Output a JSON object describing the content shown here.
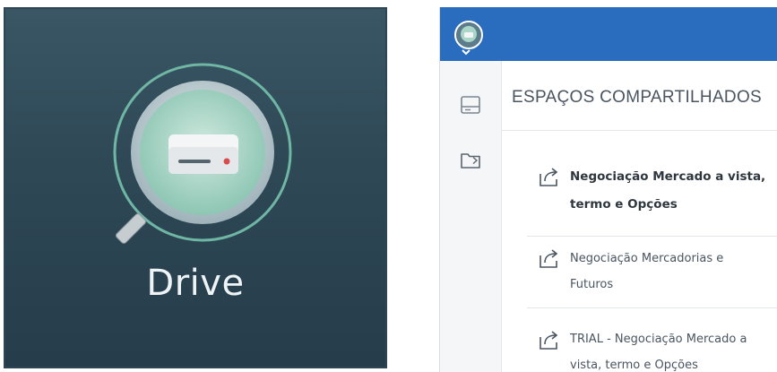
{
  "drive_tile": {
    "label": "Drive",
    "icon": "hard-drive-icon",
    "colors": {
      "background": "#2f4957",
      "ring": "#6fb7a4",
      "disc": "#a9d6c7",
      "drive": "#f1f3f4",
      "led": "#d94c4c"
    }
  },
  "header": {
    "avatar": "user-avatar",
    "menu_icon": "chevron-down-icon",
    "color": "#2a6cbe"
  },
  "sidebar": {
    "items": [
      {
        "icon": "drive-icon"
      },
      {
        "icon": "shared-folder-icon"
      }
    ]
  },
  "main": {
    "section_title": "ESPAÇOS COMPARTILHADOS",
    "spaces": [
      {
        "line1": "Negociação Mercado a vista,",
        "line2": "termo e Opções",
        "icon": "shared-space-icon",
        "selected": true
      },
      {
        "line1": "Negociação Mercadorias e",
        "line2": "Futuros",
        "icon": "shared-space-icon",
        "selected": false
      },
      {
        "line1": "TRIAL - Negociação Mercado a",
        "line2": "vista, termo e Opções",
        "icon": "shared-space-icon",
        "selected": false
      }
    ]
  }
}
